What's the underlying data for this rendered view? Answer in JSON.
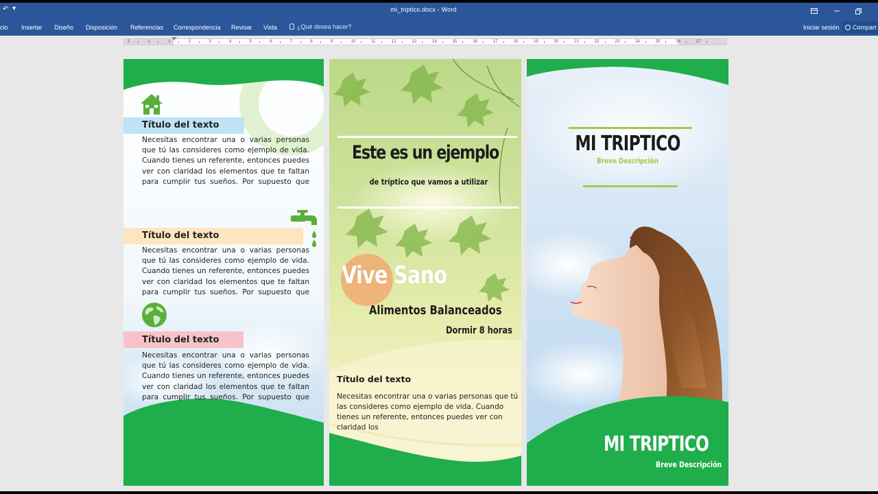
{
  "window": {
    "title": "mi_triptico.docx - Word"
  },
  "ribbon": {
    "tabs": [
      "cio",
      "Insertar",
      "Diseño",
      "Disposición",
      "Referencias",
      "Correspondencia",
      "Revisar",
      "Vista"
    ],
    "tell_me": "¿Qué desea hacer?",
    "sign_in": "Iniciar sesión",
    "share": "Compart"
  },
  "ruler": {
    "numbers": [
      "2",
      "1",
      "1",
      "2",
      "3",
      "4",
      "5",
      "6",
      "7",
      "8",
      "9",
      "10",
      "11",
      "12",
      "13",
      "14",
      "15",
      "16",
      "17",
      "18",
      "19",
      "20",
      "21",
      "22",
      "23",
      "24",
      "25",
      "26",
      "27"
    ]
  },
  "panel1": {
    "sections": [
      {
        "title": "Título del texto",
        "body": "Necesitas encontrar una o varias personas que tú las consideres como ejemplo de vida. Cuando tienes un referente, entonces puedes ver con claridad los elementos que te faltan para cumplir tus sueños. Por supuesto que escribirás",
        "icon": "house-icon",
        "bar_color": "#bfe3f5"
      },
      {
        "title": "Título del texto",
        "body": "Necesitas encontrar una o varias personas que tú las consideres como ejemplo de vida. Cuando tienes un referente, entonces puedes ver con claridad los elementos que te faltan para cumplir tus sueños. Por supuesto que escribirás",
        "icon": "faucet-icon",
        "bar_color": "#fbe6c0"
      },
      {
        "title": "Título del texto",
        "body": "Necesitas encontrar una o varias personas que tú las consideres como ejemplo de vida. Cuando tienes un referente, entonces puedes ver con claridad los elementos que te faltan para cumplir tus sueños. Por supuesto que escribirás",
        "icon": "globe-icon",
        "bar_color": "#f7c3c8"
      }
    ]
  },
  "panel2": {
    "heading": "Este es un ejemplo",
    "subheading": "de tríptico  que vamos a utilizar",
    "vive": "Vive Sano",
    "alimentos": "Alimentos Balanceados",
    "dormir": "Dormir 8 horas",
    "section_title": "Título del texto",
    "section_body": "Necesitas encontrar una o varias personas que tú las consideres como ejemplo de vida. Cuando tienes un referente, entonces puedes ver con claridad los"
  },
  "panel3": {
    "title": "MI TRIPTICO",
    "subtitle": "Breve Descripción",
    "footer_title": "MI TRIPTICO",
    "footer_subtitle": "Breve Descripción"
  },
  "colors": {
    "word_blue": "#2b579a",
    "green": "#1fae4b",
    "light_green": "#9ccc4a"
  }
}
